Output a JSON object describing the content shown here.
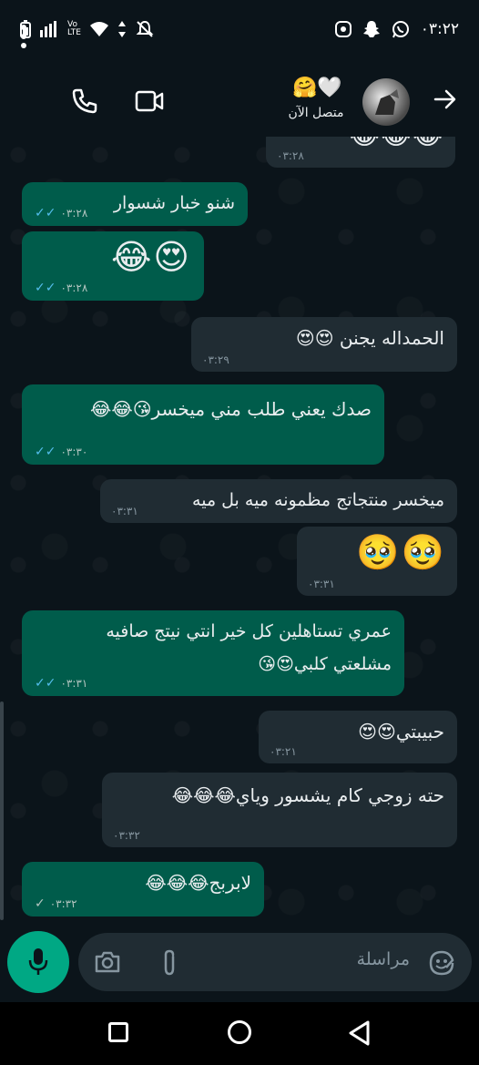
{
  "status_bar": {
    "time": "٠٣:٢٢",
    "left_icons": [
      "battery-icon",
      "signal-icon",
      "volte-icon",
      "wifi-icon",
      "data-arrows-icon",
      "mute-icon"
    ],
    "right_icons": [
      "notification-icon",
      "snapchat-icon",
      "whatsapp-icon"
    ]
  },
  "header": {
    "status": "متصل الآن",
    "name_emojis": "🤗🤍",
    "icons": [
      "menu-icon",
      "call-icon",
      "video-icon",
      "back-arrow-icon"
    ]
  },
  "messages": [
    {
      "dir": "in",
      "text": "😂😂😂",
      "time": "٠٣:٢٨"
    },
    {
      "dir": "out",
      "text": "شنو خبار شسوار",
      "time": "٠٣:٢٨",
      "ticks": "✓✓"
    },
    {
      "dir": "out",
      "text": "😂😍",
      "time": "٠٣:٢٨",
      "ticks": "✓✓"
    },
    {
      "dir": "in",
      "text": "الحمداله يجنن 😍😍",
      "time": "٠٣:٢٩"
    },
    {
      "dir": "out",
      "text": "صدك يعني طلب مني ميخسر😘😂😂",
      "time": "٠٣:٣٠",
      "ticks": "✓✓"
    },
    {
      "dir": "in",
      "text": "ميخسر منتجاتج مظمونه ميه بل ميه",
      "time": "٠٣:٣١"
    },
    {
      "dir": "in",
      "text": "🥹🥹",
      "time": "٠٣:٣١"
    },
    {
      "dir": "out",
      "text": "عمري تستاهلين كل خير انتي نيتج صافيه",
      "text2": "مشلعتي كلبي😍😘",
      "time": "٠٣:٣١",
      "ticks": "✓✓"
    },
    {
      "dir": "in",
      "text": "حبيبتي😍😍",
      "time": "٠٣:٢١"
    },
    {
      "dir": "in",
      "text": "حته زوجي كام يشسور وياي😂😂😂",
      "time": "٠٣:٣٢"
    },
    {
      "dir": "out",
      "text": "لابربج😂😂😂",
      "time": "٠٣:٣٢",
      "ticks": "✓"
    }
  ],
  "composer": {
    "placeholder": "مراسلة",
    "icons": [
      "mic-icon",
      "camera-icon",
      "attach-icon",
      "emoji-sticker-icon"
    ]
  },
  "nav": {
    "icons": [
      "recents-icon",
      "home-icon",
      "back-icon"
    ]
  },
  "colors": {
    "background": "#0b141a",
    "outgoing_bubble": "#005c4b",
    "incoming_bubble": "#202c33",
    "read_ticks": "#53bdeb",
    "accent": "#00a884"
  }
}
